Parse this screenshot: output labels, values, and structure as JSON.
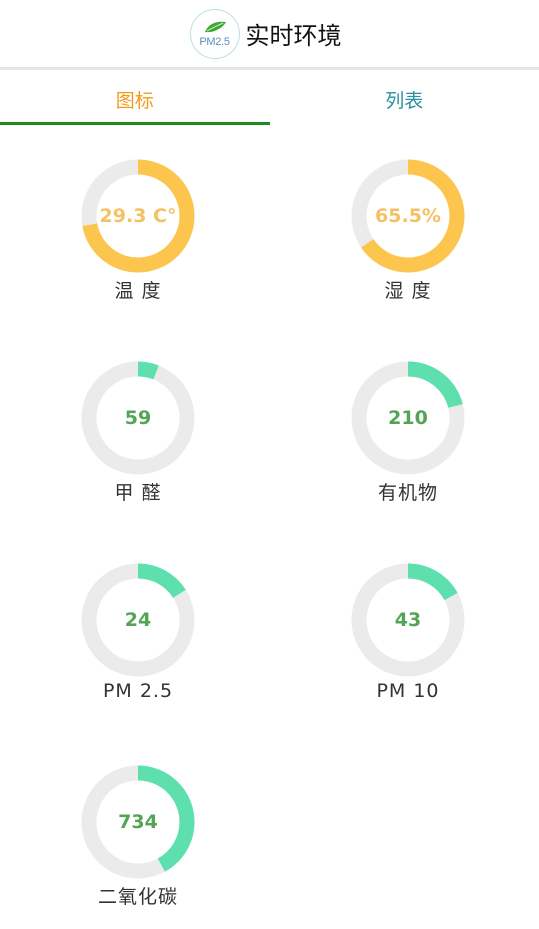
{
  "header": {
    "logo_text": "PM2.5",
    "title": "实时环境"
  },
  "tabs": [
    {
      "label": "图标"
    },
    {
      "label": "列表"
    }
  ],
  "colors": {
    "track": "#ebebeb",
    "yellow": "#fcc54e",
    "green": "#5ddfae",
    "value_yellow": "#f5c165",
    "value_green": "#55a455"
  },
  "gauges": [
    {
      "label": "温 度",
      "value": "29.3 C°",
      "fraction": 0.72,
      "color": "yellow"
    },
    {
      "label": "湿 度",
      "value": "65.5%",
      "fraction": 0.655,
      "color": "yellow"
    },
    {
      "label": "甲 醛",
      "value": "59",
      "fraction": 0.06,
      "color": "green"
    },
    {
      "label": "有机物",
      "value": "210",
      "fraction": 0.21,
      "color": "green"
    },
    {
      "label": "PM 2.5",
      "value": "24",
      "fraction": 0.16,
      "color": "green"
    },
    {
      "label": "PM 10",
      "value": "43",
      "fraction": 0.17,
      "color": "green"
    },
    {
      "label": "二氧化碳",
      "value": "734",
      "fraction": 0.42,
      "color": "green"
    }
  ]
}
